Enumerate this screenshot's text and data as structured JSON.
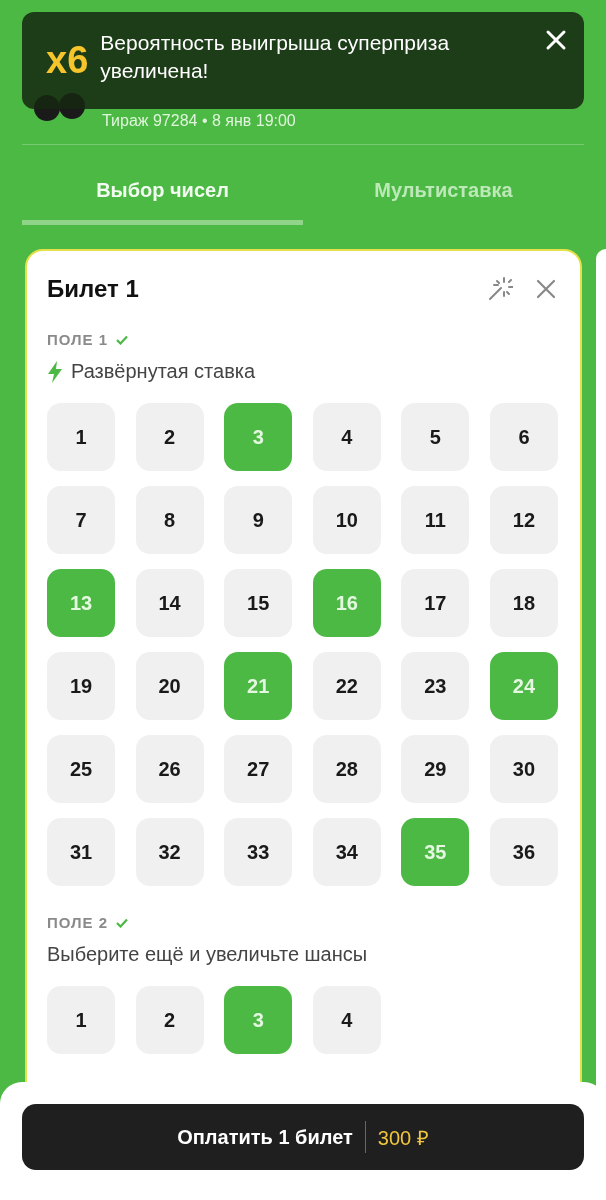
{
  "header": {
    "draw": "Тираж 97284 • 8 янв 19:00"
  },
  "toast": {
    "multiplier": "x6",
    "message": "Вероятность выигрыша суперприза увеличена!"
  },
  "tabs": [
    {
      "label": "Выбор чисел",
      "selected": true
    },
    {
      "label": "Мультиставка",
      "selected": false
    }
  ],
  "ticket": {
    "title": "Билет 1",
    "fields": [
      {
        "label": "ПОЛЕ 1",
        "done": true,
        "kind": "bolt",
        "hint": "Развёрнутая ставка",
        "numbers": [
          {
            "label": "1",
            "selected": false
          },
          {
            "label": "2",
            "selected": false
          },
          {
            "label": "3",
            "selected": true
          },
          {
            "label": "4",
            "selected": false
          },
          {
            "label": "5",
            "selected": false
          },
          {
            "label": "6",
            "selected": false
          },
          {
            "label": "7",
            "selected": false
          },
          {
            "label": "8",
            "selected": false
          },
          {
            "label": "9",
            "selected": false
          },
          {
            "label": "10",
            "selected": false
          },
          {
            "label": "11",
            "selected": false
          },
          {
            "label": "12",
            "selected": false
          },
          {
            "label": "13",
            "selected": true
          },
          {
            "label": "14",
            "selected": false
          },
          {
            "label": "15",
            "selected": false
          },
          {
            "label": "16",
            "selected": true
          },
          {
            "label": "17",
            "selected": false
          },
          {
            "label": "18",
            "selected": false
          },
          {
            "label": "19",
            "selected": false
          },
          {
            "label": "20",
            "selected": false
          },
          {
            "label": "21",
            "selected": true
          },
          {
            "label": "22",
            "selected": false
          },
          {
            "label": "23",
            "selected": false
          },
          {
            "label": "24",
            "selected": true
          },
          {
            "label": "25",
            "selected": false
          },
          {
            "label": "26",
            "selected": false
          },
          {
            "label": "27",
            "selected": false
          },
          {
            "label": "28",
            "selected": false
          },
          {
            "label": "29",
            "selected": false
          },
          {
            "label": "30",
            "selected": false
          },
          {
            "label": "31",
            "selected": false
          },
          {
            "label": "32",
            "selected": false
          },
          {
            "label": "33",
            "selected": false
          },
          {
            "label": "34",
            "selected": false
          },
          {
            "label": "35",
            "selected": true
          },
          {
            "label": "36",
            "selected": false
          }
        ]
      },
      {
        "label": "ПОЛЕ 2",
        "done": true,
        "kind": "plain",
        "hint": "Выберите ещё и увеличьте шансы",
        "numbers": [
          {
            "label": "1",
            "selected": false
          },
          {
            "label": "2",
            "selected": false
          },
          {
            "label": "3",
            "selected": true
          },
          {
            "label": "4",
            "selected": false
          }
        ]
      }
    ]
  },
  "pay": {
    "label": "Оплатить 1 билет",
    "price": "300 ₽"
  }
}
